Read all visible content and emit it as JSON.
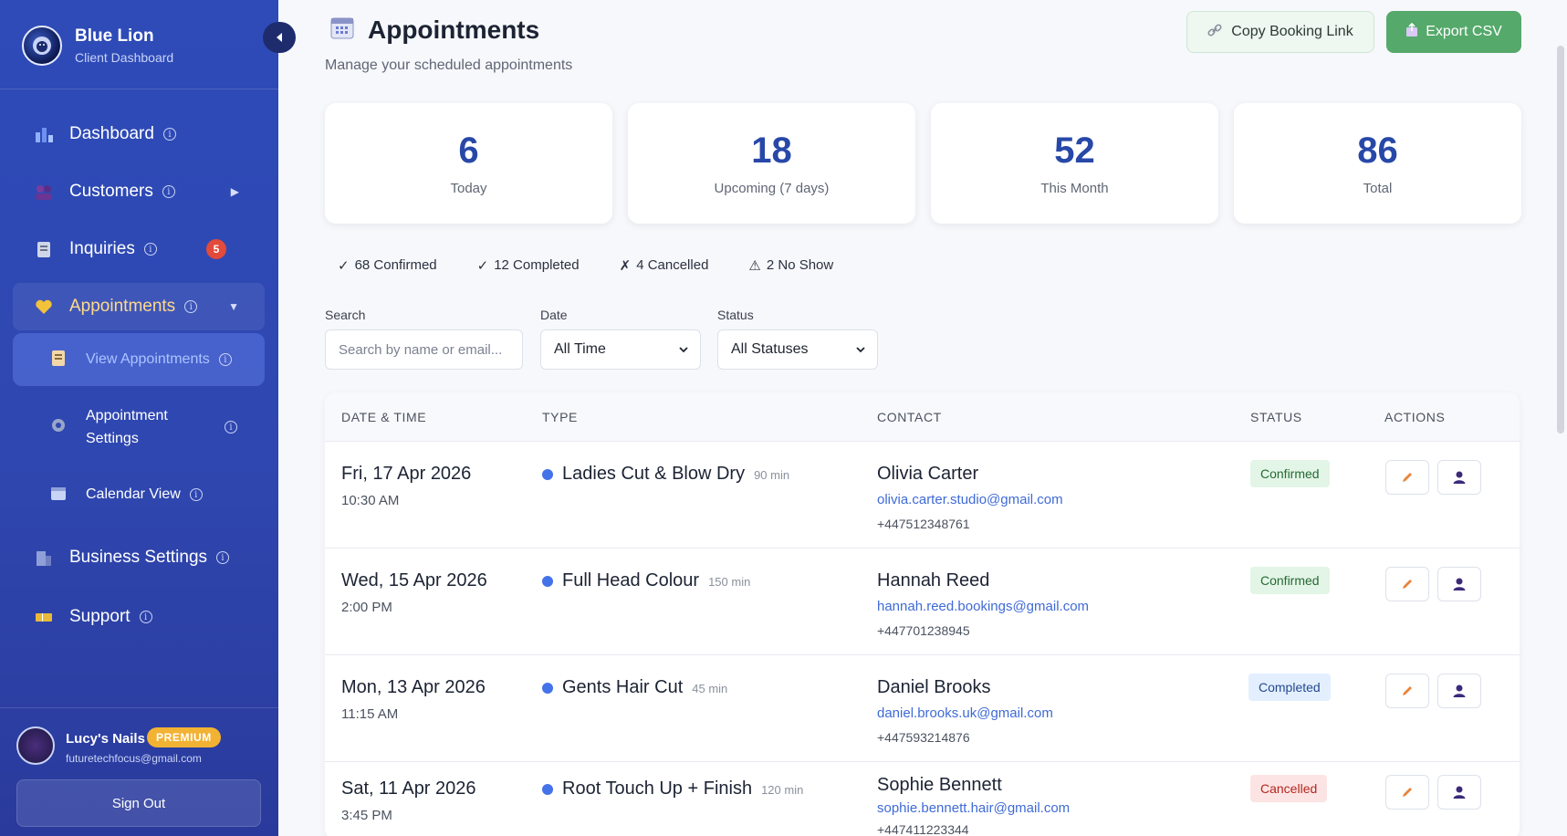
{
  "brand": {
    "title": "Blue Lion",
    "subtitle": "Client Dashboard"
  },
  "sidebar": {
    "items": [
      {
        "label": "Dashboard",
        "icon": "chart-icon"
      },
      {
        "label": "Customers",
        "icon": "users-icon"
      },
      {
        "label": "Inquiries",
        "icon": "clipboard-icon",
        "badge": "5"
      },
      {
        "label": "Appointments",
        "icon": "heart-icon"
      },
      {
        "label": "Business Settings",
        "icon": "building-icon"
      },
      {
        "label": "Support",
        "icon": "ticket-icon"
      }
    ],
    "sub_items": [
      {
        "label": "View Appointments"
      },
      {
        "label": "Appointment Settings"
      },
      {
        "label": "Calendar View"
      }
    ]
  },
  "profile": {
    "name": "Lucy's Nails",
    "plan": "PREMIUM",
    "email": "futuretechfocus@gmail.com",
    "sign_out": "Sign Out"
  },
  "header": {
    "title": "Appointments",
    "subtitle": "Manage your scheduled appointments",
    "copy_link": "Copy Booking Link",
    "export": "Export CSV"
  },
  "stats": [
    {
      "value": "6",
      "label": "Today"
    },
    {
      "value": "18",
      "label": "Upcoming (7 days)"
    },
    {
      "value": "52",
      "label": "This Month"
    },
    {
      "value": "86",
      "label": "Total"
    }
  ],
  "summary": [
    {
      "icon": "✓",
      "text": "68 Confirmed"
    },
    {
      "icon": "✓",
      "text": "12 Completed"
    },
    {
      "icon": "✗",
      "text": "4 Cancelled"
    },
    {
      "icon": "⚠",
      "text": "2 No Show"
    }
  ],
  "filters": {
    "search_label": "Search",
    "search_placeholder": "Search by name or email...",
    "date_label": "Date",
    "date_value": "All Time",
    "status_label": "Status",
    "status_value": "All Statuses"
  },
  "table": {
    "headers": [
      "DATE & TIME",
      "TYPE",
      "CONTACT",
      "STATUS",
      "ACTIONS"
    ],
    "rows": [
      {
        "date": "Fri, 17 Apr 2026",
        "time": "10:30 AM",
        "type": "Ladies Cut & Blow Dry",
        "duration": "90 min",
        "name": "Olivia Carter",
        "email": "olivia.carter.studio@gmail.com",
        "phone": "+447512348761",
        "status": "Confirmed"
      },
      {
        "date": "Wed, 15 Apr 2026",
        "time": "2:00 PM",
        "type": "Full Head Colour",
        "duration": "150 min",
        "name": "Hannah Reed",
        "email": "hannah.reed.bookings@gmail.com",
        "phone": "+447701238945",
        "status": "Confirmed"
      },
      {
        "date": "Mon, 13 Apr 2026",
        "time": "11:15 AM",
        "type": "Gents Hair Cut",
        "duration": "45 min",
        "name": "Daniel Brooks",
        "email": "daniel.brooks.uk@gmail.com",
        "phone": "+447593214876",
        "status": "Completed"
      },
      {
        "date": "Sat, 11 Apr 2026",
        "time": "3:45 PM",
        "type": "Root Touch Up + Finish",
        "duration": "120 min",
        "name": "Sophie Bennett",
        "email": "sophie.bennett.hair@gmail.com",
        "phone": "+447411223344",
        "status": "Cancelled"
      }
    ]
  },
  "colors": {
    "sidebar": "#2e4bb8",
    "accent": "#2848a8",
    "export": "#55a96b",
    "link": "#3f6bd6"
  }
}
